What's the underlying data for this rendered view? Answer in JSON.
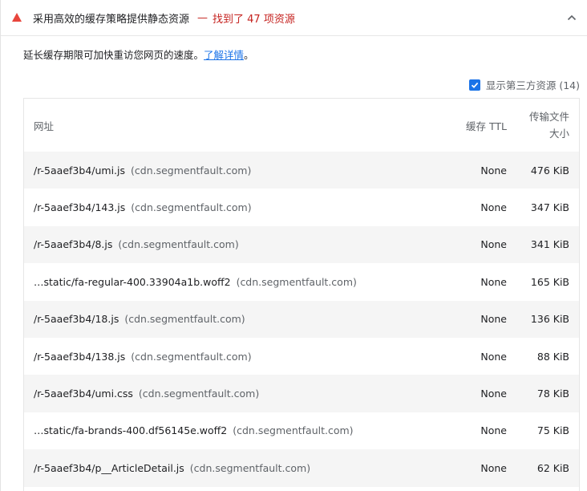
{
  "header": {
    "title": "采用高效的缓存策略提供静态资源",
    "separator": "—",
    "count": "找到了 47 项资源"
  },
  "description": {
    "text": "延长缓存期限可加快重访您网页的速度。",
    "link": "了解详情",
    "end": "。"
  },
  "filter": {
    "label": "显示第三方资源 (14)",
    "checked": true
  },
  "table": {
    "columns": {
      "url": "网址",
      "ttl": "缓存 TTL",
      "size_line1": "传输文件",
      "size_line2": "大小"
    },
    "rows": [
      {
        "path": "/r-5aaef3b4/umi.js",
        "host": "(cdn.segmentfault.com)",
        "ttl": "None",
        "size": "476 KiB"
      },
      {
        "path": "/r-5aaef3b4/143.js",
        "host": "(cdn.segmentfault.com)",
        "ttl": "None",
        "size": "347 KiB"
      },
      {
        "path": "/r-5aaef3b4/8.js",
        "host": "(cdn.segmentfault.com)",
        "ttl": "None",
        "size": "341 KiB"
      },
      {
        "path": "…static/fa-regular-400.33904a1b.woff2",
        "host": "(cdn.segmentfault.com)",
        "ttl": "None",
        "size": "165 KiB"
      },
      {
        "path": "/r-5aaef3b4/18.js",
        "host": "(cdn.segmentfault.com)",
        "ttl": "None",
        "size": "136 KiB"
      },
      {
        "path": "/r-5aaef3b4/138.js",
        "host": "(cdn.segmentfault.com)",
        "ttl": "None",
        "size": "88 KiB"
      },
      {
        "path": "/r-5aaef3b4/umi.css",
        "host": "(cdn.segmentfault.com)",
        "ttl": "None",
        "size": "78 KiB"
      },
      {
        "path": "…static/fa-brands-400.df56145e.woff2",
        "host": "(cdn.segmentfault.com)",
        "ttl": "None",
        "size": "75 KiB"
      },
      {
        "path": "/r-5aaef3b4/p__ArticleDetail.js",
        "host": "(cdn.segmentfault.com)",
        "ttl": "None",
        "size": "62 KiB"
      }
    ]
  },
  "colors": {
    "warning": "#e8453c",
    "link": "#1a73e8",
    "row_stripe": "#f5f5f5"
  },
  "icons": {
    "warning": "warning-triangle-icon",
    "collapse": "chevron-up-icon",
    "check": "checkmark-icon"
  }
}
